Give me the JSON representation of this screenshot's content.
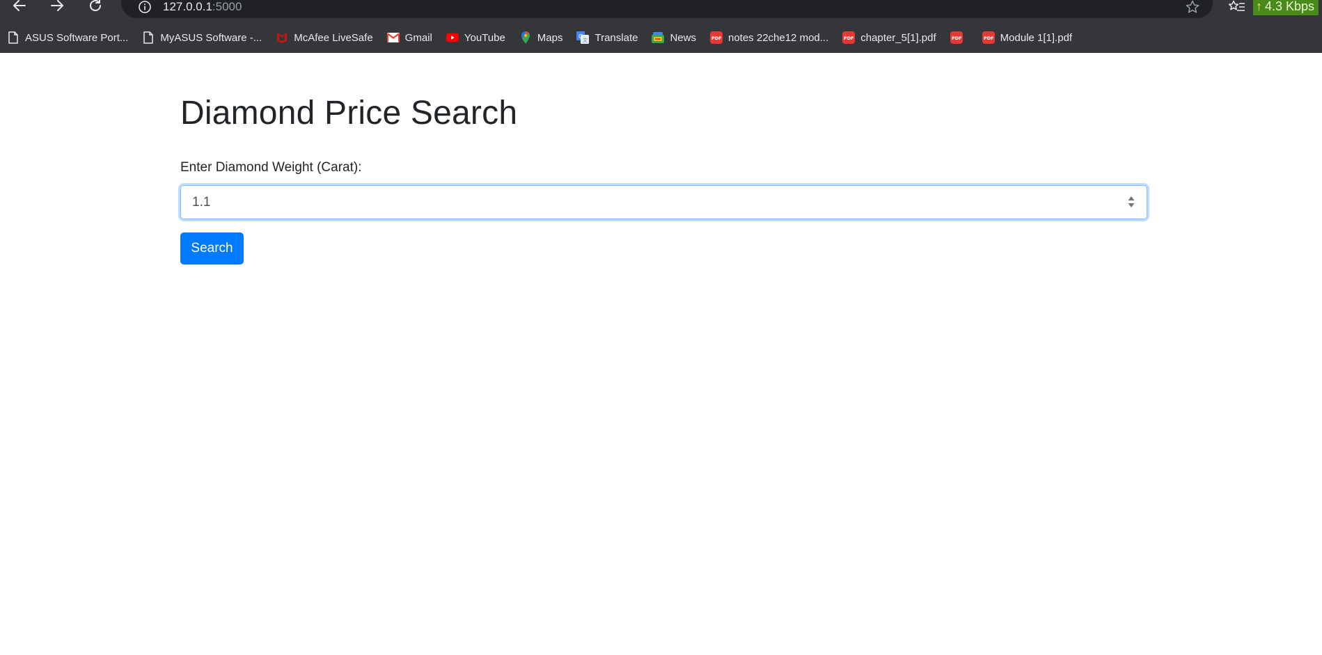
{
  "browser": {
    "url_host": "127.0.0.1",
    "url_port": ":5000",
    "network_speed": "4.3 Kbps",
    "bookmarks": [
      {
        "label": "ASUS Software Port...",
        "icon": "page-icon"
      },
      {
        "label": "MyASUS Software -...",
        "icon": "page-icon"
      },
      {
        "label": "McAfee LiveSafe",
        "icon": "mcafee-icon"
      },
      {
        "label": "Gmail",
        "icon": "gmail-icon"
      },
      {
        "label": "YouTube",
        "icon": "youtube-icon"
      },
      {
        "label": "Maps",
        "icon": "maps-icon"
      },
      {
        "label": "Translate",
        "icon": "translate-icon"
      },
      {
        "label": "News",
        "icon": "news-icon"
      },
      {
        "label": "notes 22che12 mod...",
        "icon": "pdf-icon"
      },
      {
        "label": "chapter_5[1].pdf",
        "icon": "pdf-icon"
      },
      {
        "label": "",
        "icon": "pdf-icon"
      },
      {
        "label": "Module 1[1].pdf",
        "icon": "pdf-icon"
      }
    ]
  },
  "page": {
    "title": "Diamond Price Search",
    "weight_label": "Enter Diamond Weight (Carat):",
    "weight_value": "1.1",
    "search_button": "Search"
  },
  "colors": {
    "primary": "#007bff",
    "text": "#212529",
    "chrome_bg": "#35363a"
  }
}
